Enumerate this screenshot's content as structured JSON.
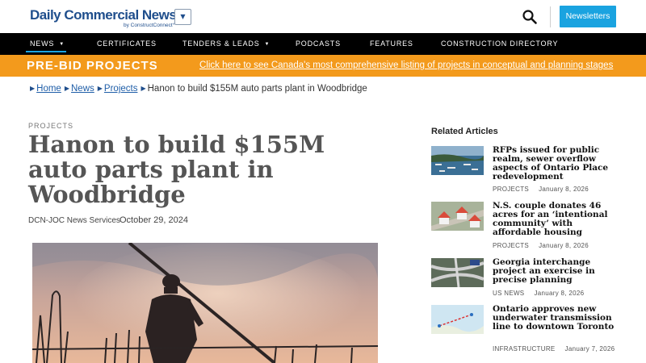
{
  "header": {
    "logo_main": "Daily Commercial News",
    "logo_sub": "by ConstructConnect°",
    "dropdown_symbol": "▼",
    "search_icon": "search-icon",
    "newsletters_label": "Newsletters",
    "accent_color": "#1aa3e0",
    "brand_color": "#1f4e8c"
  },
  "nav": {
    "items": [
      {
        "label": "NEWS",
        "caret": "▼"
      },
      {
        "label": "CERTIFICATES"
      },
      {
        "label": "TENDERS & LEADS",
        "caret": "▼"
      },
      {
        "label": "PODCASTS"
      },
      {
        "label": "FEATURES"
      },
      {
        "label": "CONSTRUCTION DIRECTORY"
      }
    ]
  },
  "banner": {
    "title": "PRE-BID PROJECTS",
    "link": "Click here to see Canada's most comprehensive listing of projects in conceptual and planning stages",
    "color": "#f39a1c"
  },
  "breadcrumb": {
    "home": "Home",
    "news": "News",
    "projects": "Projects",
    "current": "Hanon to build $155M auto parts plant in Woodbridge"
  },
  "article": {
    "category": "PROJECTS",
    "title": "Hanon to build $155M auto parts plant in Woodbridge",
    "byline": "DCN-JOC News Services",
    "date": "October 29, 2024"
  },
  "related": {
    "heading": "Related Articles",
    "items": [
      {
        "title": "RFPs issued for public realm, sewer overflow aspects of Ontario Place redevelopment",
        "category": "PROJECTS",
        "date": "January 8, 2026"
      },
      {
        "title": "N.S. couple donates 46 acres for an ‘intentional community’ with affordable housing",
        "category": "PROJECTS",
        "date": "January 8, 2026"
      },
      {
        "title": "Georgia interchange project an exercise in precise planning",
        "category": "US NEWS",
        "date": "January 8, 2026"
      },
      {
        "title": "Ontario approves new underwater transmission line to downtown Toronto",
        "category": "INFRASTRUCTURE",
        "date": "January 7, 2026"
      }
    ]
  }
}
